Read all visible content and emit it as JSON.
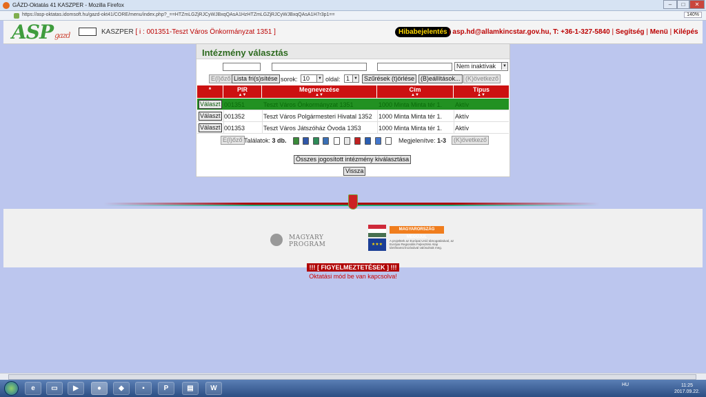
{
  "browser": {
    "title": "GÁZD-Oktatás 41 KASZPER - Mozilla Firefox",
    "url": "https://asp-oktatas.idomsoft.hu/gazd-okt41/CORE/menu/index.php?_==HTZmLGZjRJCyWJBxqQAsA1HzHTZmLGZjRJCyWJBxqQAsA1H7r3p1==",
    "zoom": "140%",
    "min_label": "–",
    "max_label": "□",
    "close_label": "✕"
  },
  "header": {
    "logo_main": "ASP",
    "logo_sub": "gazd",
    "app_name": "KASZPER",
    "institution": "[ i : 001351-Teszt Város Önkormányzat 1351 ]",
    "error_report": "Hibabejelentés",
    "email": "asp.hd@allamkincstar.gov.hu",
    "phone": "T: +36-1-327-5840",
    "help": "Segítség",
    "menu": "Menü",
    "logout": "Kilépés",
    "sep": "|"
  },
  "panel": {
    "title": "Intézmény választás",
    "status_filter": "Nem inaktívak",
    "prev": "E(l)őző",
    "refresh": "Lista fri(s)sítése",
    "rows_label": "sorok:",
    "rows_value": "10",
    "page_label": "oldal:",
    "page_value": "1",
    "clear_filters": "Szűrések (t)örlése",
    "settings": "(B)eállítások...",
    "next": "(K)övetkező",
    "results_label": "Találatok:",
    "results_count": "3 db.",
    "shown_label": "Megjelenítve:",
    "shown_range": "1-3",
    "select_all": "Összes jogosított intézmény kiválasztása",
    "back": "Vissza"
  },
  "table": {
    "headers": [
      "*",
      "PIR",
      "Megnevezése",
      "Cím",
      "Típus"
    ],
    "sort_marks": "▲▼",
    "select_label": "Választ",
    "rows": [
      {
        "pir": "001351",
        "name": "Teszt Város Önkormányzat 1351",
        "address": "1000 Minta Minta tér 1.",
        "type": "Aktív",
        "selected": true
      },
      {
        "pir": "001352",
        "name": "Teszt Város Polgármesteri Hivatal 1352",
        "address": "1000 Minta Minta tér 1.",
        "type": "Aktív",
        "selected": false
      },
      {
        "pir": "001353",
        "name": "Teszt Város Játszóház Óvoda 1353",
        "address": "1000 Minta Minta tér 1.",
        "type": "Aktív",
        "selected": false
      }
    ]
  },
  "footer": {
    "program_logo_line1": "MAGYARY",
    "program_logo_line2": "PROGRAM",
    "eu_banner": "MAGYARORSZÁG MEGÚJUL",
    "eu_text": "A projektek az Európai Unió támogatásával, az Európai Regionális Fejlesztési Alap társfinanszírozásával valósulnak meg.",
    "warning_title": "!!! [ FIGYELMEZTETÉSEK ] !!!",
    "warning_message": "Oktatási mód be van kapcsolva!"
  },
  "taskbar": {
    "word_label": "W",
    "lang": "HU",
    "time": "11:25",
    "date": "2017.09.22."
  },
  "colors": {
    "header_red": "#cc1111",
    "selected_row": "#229122",
    "title_green": "#2d6a1f",
    "background": "#bcc6ee"
  }
}
